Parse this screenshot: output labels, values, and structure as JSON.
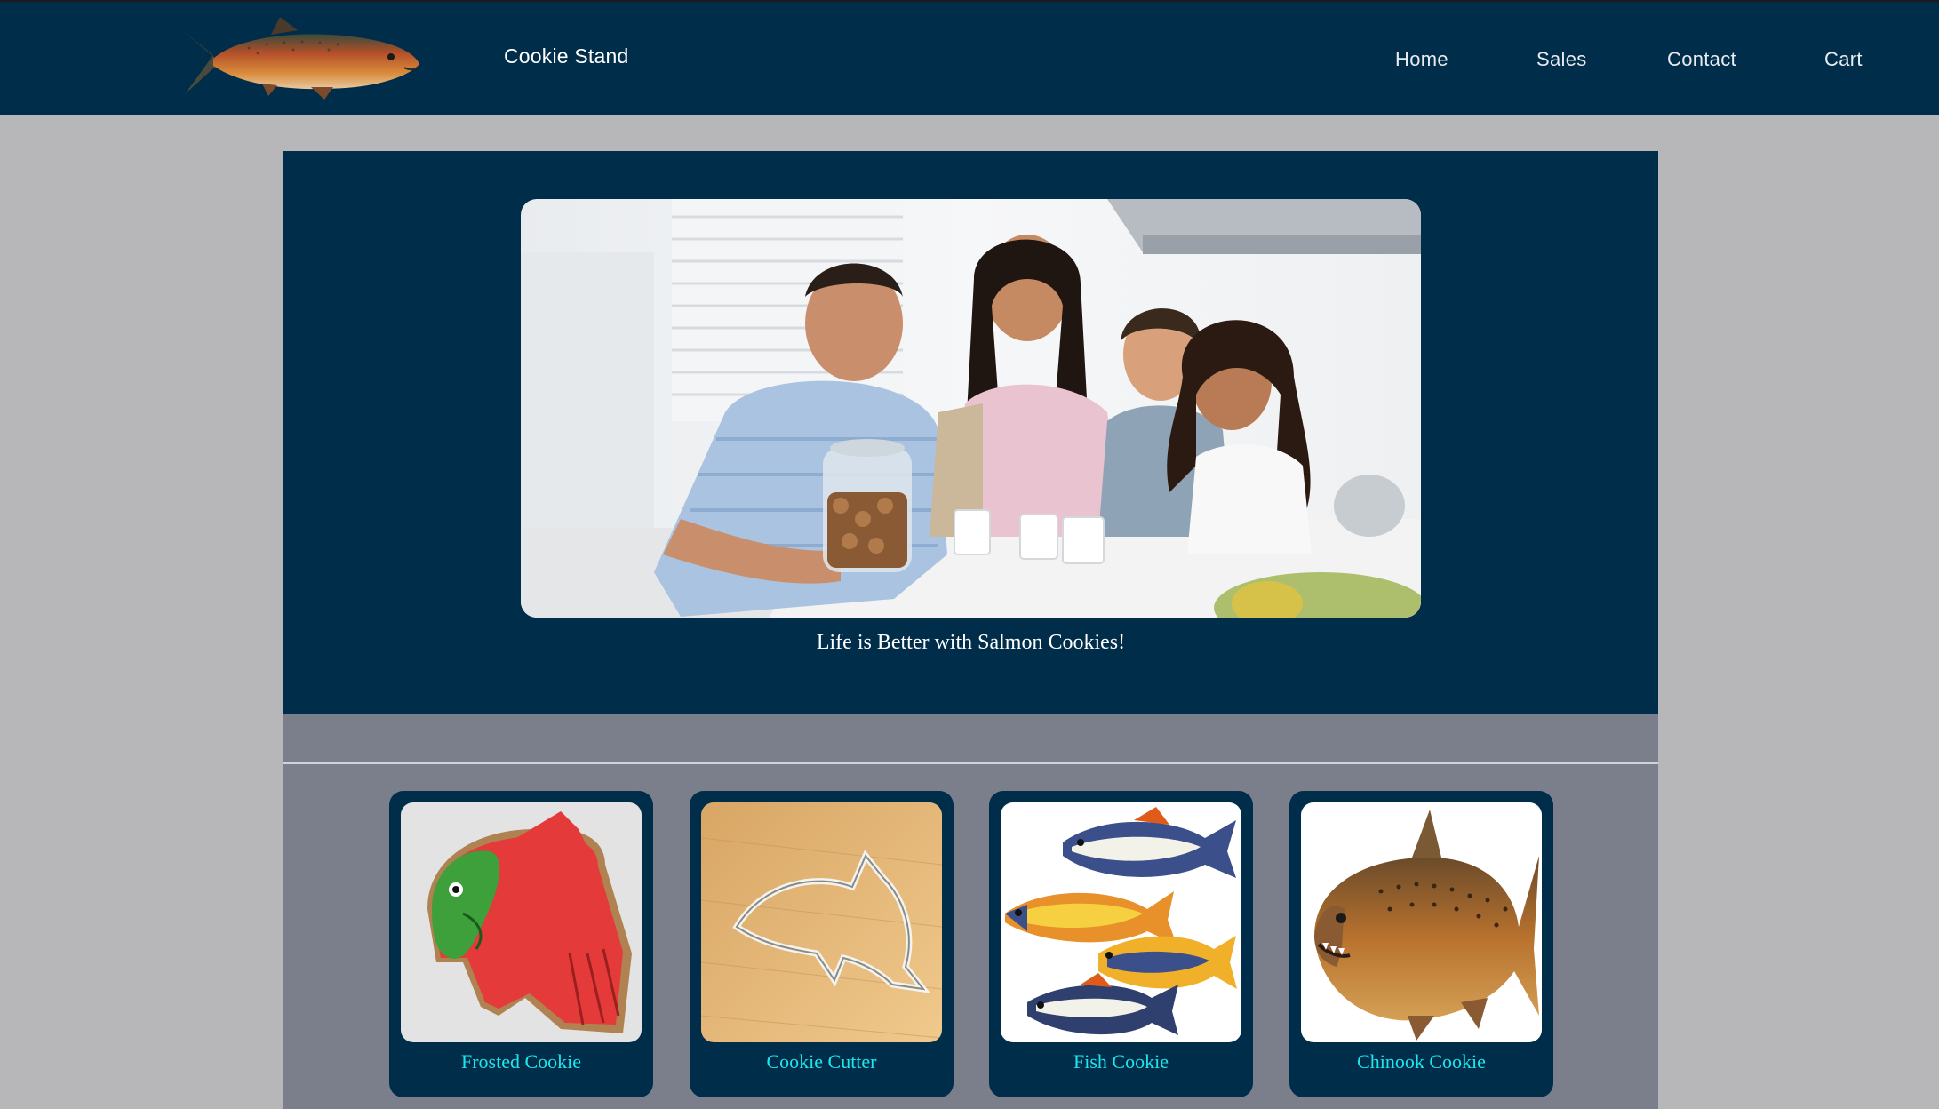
{
  "header": {
    "brand": "Cookie Stand",
    "logo_icon": "salmon-icon",
    "nav": [
      {
        "label": "Home"
      },
      {
        "label": "Sales"
      },
      {
        "label": "Contact"
      },
      {
        "label": "Cart"
      }
    ]
  },
  "hero": {
    "image": "family-kitchen-photo",
    "tagline": "Life is Better with Salmon Cookies!"
  },
  "products": [
    {
      "label": "Frosted Cookie",
      "image": "frosted-salmon-cookie"
    },
    {
      "label": "Cookie Cutter",
      "image": "fish-cookie-cutter"
    },
    {
      "label": "Fish Cookie",
      "image": "decorated-fish-cookies"
    },
    {
      "label": "Chinook Cookie",
      "image": "chinook-salmon"
    }
  ],
  "colors": {
    "navy": "#002d49",
    "page_bg": "#b7b7b9",
    "panel_bg": "#7a7f8b",
    "link_cyan": "#1ee6ee"
  }
}
